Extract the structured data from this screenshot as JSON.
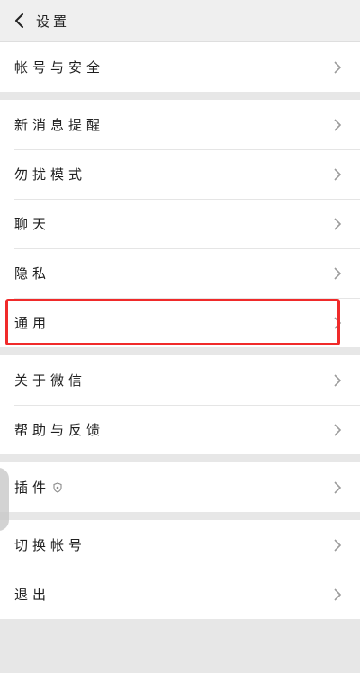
{
  "header": {
    "title": "设置"
  },
  "sections": [
    {
      "items": [
        {
          "label": "帐号与安全"
        }
      ]
    },
    {
      "items": [
        {
          "label": "新消息提醒"
        },
        {
          "label": "勿扰模式"
        },
        {
          "label": "聊天"
        },
        {
          "label": "隐私"
        },
        {
          "label": "通用"
        }
      ]
    },
    {
      "items": [
        {
          "label": "关于微信"
        },
        {
          "label": "帮助与反馈"
        }
      ]
    },
    {
      "items": [
        {
          "label": "插件"
        }
      ]
    },
    {
      "items": [
        {
          "label": "切换帐号"
        },
        {
          "label": "退出"
        }
      ]
    }
  ],
  "highlight": {
    "target": "通用",
    "color": "#f02a2a"
  },
  "icons": {
    "back": "chevron-left-icon",
    "chevron": "chevron-right-icon",
    "plugin": "shield-icon"
  }
}
